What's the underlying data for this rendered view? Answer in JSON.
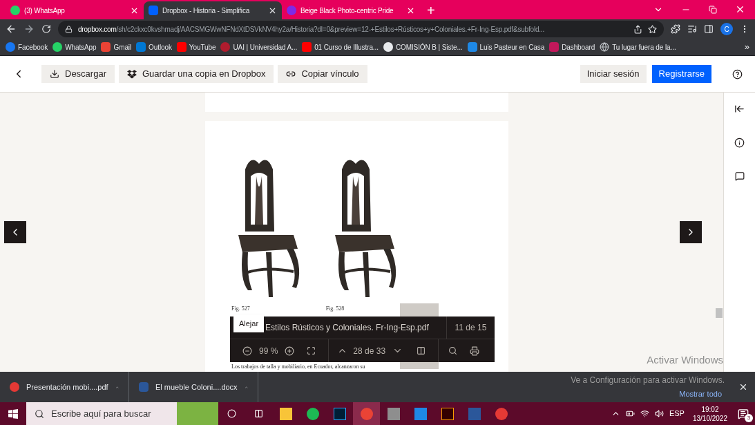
{
  "tabs": [
    {
      "title": "(3) WhatsApp",
      "selected": false,
      "kind": "whatsapp"
    },
    {
      "title": "Dropbox - Historia - Simplifica",
      "selected": true,
      "kind": "dropbox"
    },
    {
      "title": "Beige Black Photo-centric Pride",
      "selected": false,
      "kind": "canva"
    }
  ],
  "new_tab": "+",
  "address": {
    "url_host": "dropbox.com",
    "url_path": "/sh/c2ckxc0kvshmadj/AACSMGWwNFNdXtDSVkNV4hy2a/Historia?dl=0&preview=12-+Estilos+Rústicos+y+Coloniales.+Fr-Ing-Esp.pdf&subfold...",
    "profile": "C"
  },
  "bookmarks": [
    {
      "label": "Facebook",
      "kind": "facebook"
    },
    {
      "label": "WhatsApp",
      "kind": "whatsapp"
    },
    {
      "label": "Gmail",
      "kind": "gmail"
    },
    {
      "label": "Outlook",
      "kind": "outlook"
    },
    {
      "label": "YouTube",
      "kind": "youtube"
    },
    {
      "label": "UAI | Universidad A...",
      "kind": "uai"
    },
    {
      "label": "01 Curso de Illustra...",
      "kind": "youtube"
    },
    {
      "label": "COMISIÓN B | Siste...",
      "kind": "classroom"
    },
    {
      "label": "Luis Pasteur en Casa",
      "kind": "pasteur"
    },
    {
      "label": "Dashboard",
      "kind": "dashboard"
    },
    {
      "label": "Tu lugar fuera de la...",
      "kind": "globe"
    }
  ],
  "bookmarks_more": "»",
  "dropbox_toolbar": {
    "download": "Descargar",
    "save_copy": "Guardar una copia en Dropbox",
    "copy_link": "Copiar vínculo",
    "sign_in": "Iniciar sesión",
    "register": "Registrarse"
  },
  "pdf_page": {
    "captions": [
      "Fig. 527",
      "Fig. 528"
    ],
    "body": "Los trabajos de talla y mobiliario, en Ecuador, alcanzaron su"
  },
  "viewer_toolbar": {
    "tooltip": "Alejar",
    "file_name": "Estilos Rústicos y Coloniales. Fr-Ing-Esp.pdf",
    "file_position": "11 de 15",
    "zoom": "99 %",
    "page": "28 de 33"
  },
  "downloads": [
    {
      "name": "Presentación mobi....pdf",
      "kind": "pdf"
    },
    {
      "name": "El mueble Coloni....docx",
      "kind": "word"
    }
  ],
  "show_all": "Mostrar todo",
  "activation": {
    "title": "Activar Windows",
    "subtitle": "Ve a Configuración para activar Windows."
  },
  "taskbar": {
    "search_placeholder": "Escribe aquí para buscar",
    "language": "ESP",
    "time": "19:02",
    "date": "13/10/2022",
    "notifications": "3"
  }
}
